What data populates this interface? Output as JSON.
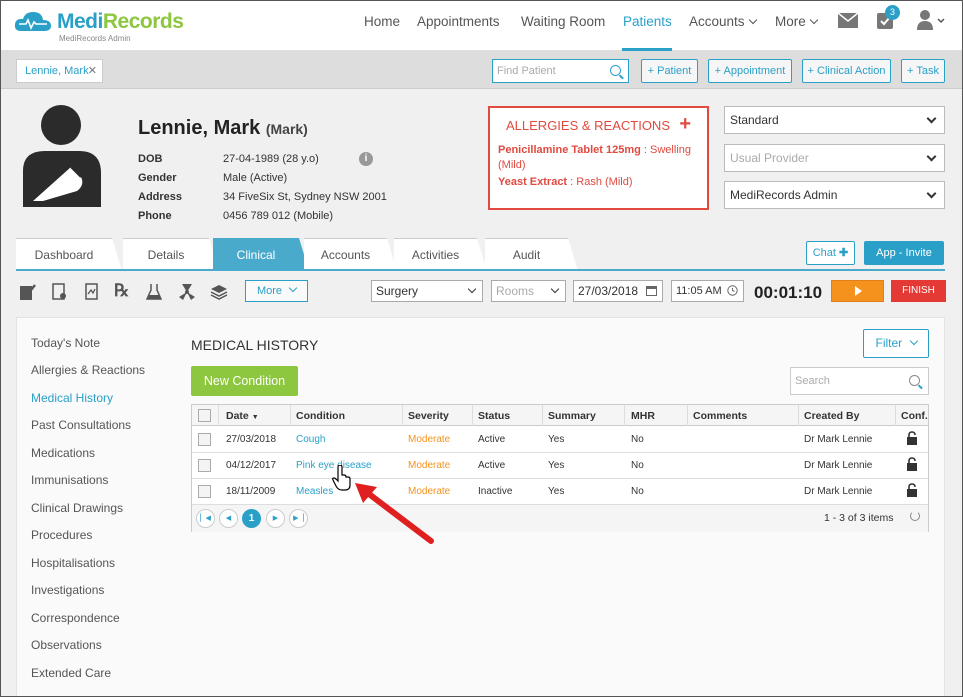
{
  "brand": {
    "name_part1": "Medi",
    "name_part2": "Records",
    "subtitle": "MediRecords Admin"
  },
  "nav": {
    "items": [
      "Home",
      "Appointments",
      "Waiting Room",
      "Patients",
      "Accounts",
      "More"
    ],
    "active": "Patients",
    "task_badge": "3"
  },
  "patient_bar": {
    "open_patient_tab": "Lennie, Mark",
    "find_placeholder": "Find Patient",
    "buttons": [
      "+ Patient",
      "+ Appointment",
      "+ Clinical Action",
      "+ Task"
    ]
  },
  "patient": {
    "name": "Lennie, Mark",
    "nickname": "(Mark)",
    "fields": [
      {
        "label": "DOB",
        "value": "27-04-1989 (28 y.o)"
      },
      {
        "label": "Gender",
        "value": "Male (Active)"
      },
      {
        "label": "Address",
        "value": "34 FiveSix St, Sydney NSW 2001"
      },
      {
        "label": "Phone",
        "value": "0456 789 012 (Mobile)"
      }
    ]
  },
  "allergies": {
    "title": "ALLERGIES & REACTIONS",
    "items": [
      {
        "agent": "Penicillamine Tablet 125mg",
        "reaction": " : Swelling (Mild)"
      },
      {
        "agent": "Yeast Extract",
        "reaction": " : Rash (Mild)"
      }
    ]
  },
  "right_selects": {
    "billing": "Standard",
    "provider_placeholder": "Usual Provider",
    "practice": "MediRecords Admin"
  },
  "tabs": [
    "Dashboard",
    "Details",
    "Clinical",
    "Accounts",
    "Activities",
    "Audit"
  ],
  "active_tab": "Clinical",
  "chat_label": "Chat",
  "app_invite_label": "App - Invite",
  "toolbar": {
    "more_label": "More",
    "location": "Surgery",
    "rooms_placeholder": "Rooms",
    "date": "27/03/2018",
    "time": "11:05 AM",
    "timer": "00:01:10",
    "finish_label": "FINISH"
  },
  "sidebar": {
    "items": [
      "Today's Note",
      "Allergies & Reactions",
      "Medical History",
      "Past Consultations",
      "Medications",
      "Immunisations",
      "Clinical Drawings",
      "Procedures",
      "Hospitalisations",
      "Investigations",
      "Correspondence",
      "Observations",
      "Extended Care"
    ],
    "active": "Medical History"
  },
  "medical_history": {
    "title": "MEDICAL HISTORY",
    "filter_label": "Filter",
    "new_condition_label": "New Condition",
    "search_placeholder": "Search",
    "columns": [
      "Date",
      "Condition",
      "Severity",
      "Status",
      "Summary",
      "MHR",
      "Comments",
      "Created By",
      "Conf."
    ],
    "rows": [
      {
        "date": "27/03/2018",
        "condition": "Cough",
        "severity": "Moderate",
        "status": "Active",
        "summary": "Yes",
        "mhr": "No",
        "comments": "",
        "created_by": "Dr Mark Lennie"
      },
      {
        "date": "04/12/2017",
        "condition": "Pink eye disease",
        "severity": "Moderate",
        "status": "Active",
        "summary": "Yes",
        "mhr": "No",
        "comments": "",
        "created_by": "Dr Mark Lennie"
      },
      {
        "date": "18/11/2009",
        "condition": "Measles",
        "severity": "Moderate",
        "status": "Inactive",
        "summary": "Yes",
        "mhr": "No",
        "comments": "",
        "created_by": "Dr Mark Lennie"
      }
    ],
    "current_page": "1",
    "pager_info": "1 - 3 of 3 items"
  },
  "colors": {
    "accent": "#2aa0c9",
    "allergy_red": "#e04a3f",
    "moderate_orange": "#f5921e",
    "new_green": "#8dc63f",
    "finish_red": "#e53935"
  }
}
